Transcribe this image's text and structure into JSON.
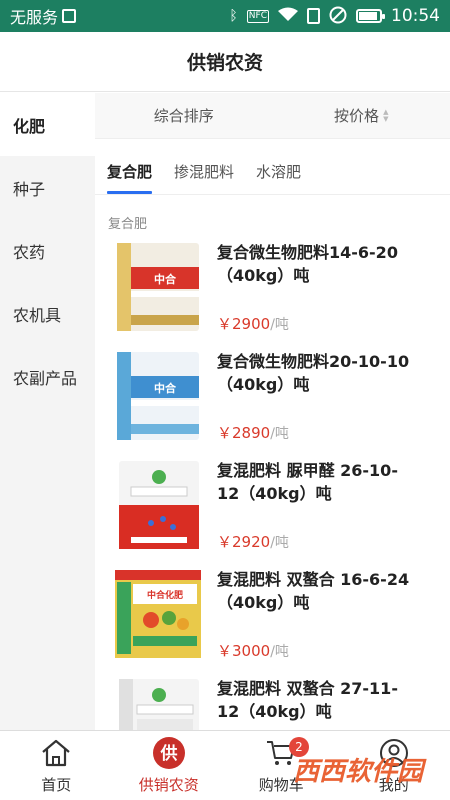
{
  "status_bar": {
    "carrier": "无服务",
    "icons": [
      "sim-icon",
      "bluetooth-icon",
      "nfc-icon",
      "wifi-icon",
      "signal-icon",
      "do-not-disturb-icon",
      "battery-icon"
    ],
    "nfc_label": "NFC",
    "time": "10:54"
  },
  "header": {
    "title": "供销农资"
  },
  "sidebar": {
    "items": [
      {
        "label": "化肥",
        "active": true
      },
      {
        "label": "种子"
      },
      {
        "label": "农药"
      },
      {
        "label": "农机具"
      },
      {
        "label": "农副产品"
      }
    ]
  },
  "sortbar": {
    "comprehensive": "综合排序",
    "by_price": "按价格"
  },
  "tabs": [
    {
      "label": "复合肥",
      "active": true
    },
    {
      "label": "掺混肥料"
    },
    {
      "label": "水溶肥"
    }
  ],
  "section_title": "复合肥",
  "products": [
    {
      "name": "复合微生物肥料14-6-20（40kg）吨",
      "price": "￥2900",
      "unit": "/吨"
    },
    {
      "name": "复合微生物肥料20-10-10（40kg）吨",
      "price": "￥2890",
      "unit": "/吨"
    },
    {
      "name": "复混肥料 脲甲醛 26-10-12（40kg）吨",
      "price": "￥2920",
      "unit": "/吨"
    },
    {
      "name": "复混肥料 双螯合 16-6-24（40kg）吨",
      "price": "￥3000",
      "unit": "/吨"
    },
    {
      "name": "复混肥料 双螯合 27-11-12（40kg）吨",
      "price": "",
      "unit": ""
    }
  ],
  "bottom_nav": {
    "items": [
      {
        "label": "首页",
        "icon": "home-icon"
      },
      {
        "label": "供销农资",
        "icon": "supply-icon",
        "active": true,
        "icon_char": "供"
      },
      {
        "label": "购物车",
        "icon": "cart-icon",
        "badge": "2"
      },
      {
        "label": "我的",
        "icon": "profile-icon"
      }
    ]
  },
  "watermark": "西西软件园",
  "colors": {
    "status_bar": "#1d7f61",
    "accent_red": "#c8302a",
    "price": "#d93a2b",
    "tab_underline": "#2a6ef0"
  }
}
